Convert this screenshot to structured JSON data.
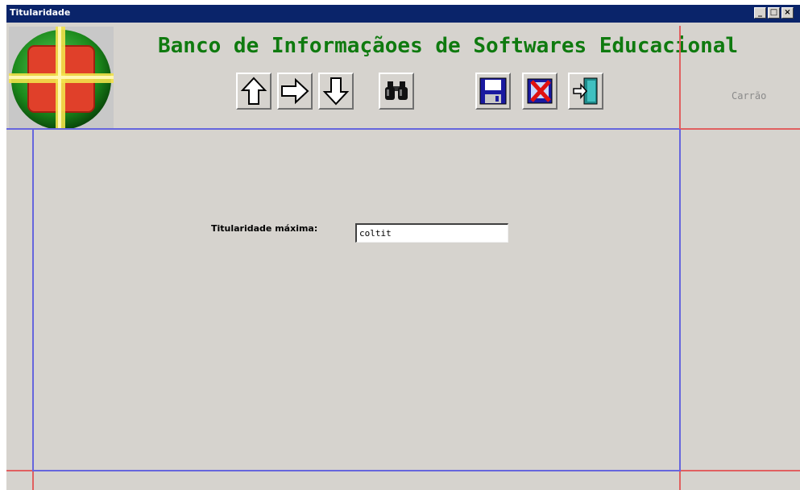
{
  "window": {
    "title": "Titularidade",
    "controls": {
      "minimize": "_",
      "maximize": "□",
      "close": "×"
    }
  },
  "header": {
    "app_title": "Banco de Informaçãoes de Softwares Educacional",
    "side_label": "Carrão"
  },
  "toolbar": {
    "buttons": [
      {
        "name": "up-arrow",
        "icon": "arrow-up-icon"
      },
      {
        "name": "right-arrow",
        "icon": "arrow-right-icon"
      },
      {
        "name": "down-arrow",
        "icon": "arrow-down-icon"
      },
      {
        "name": "find",
        "icon": "binoculars-icon"
      },
      {
        "name": "save",
        "icon": "floppy-disk-icon"
      },
      {
        "name": "delete",
        "icon": "delete-x-icon"
      },
      {
        "name": "exit",
        "icon": "exit-door-icon"
      }
    ]
  },
  "form": {
    "titularidade_label": "Titularidade máxima:",
    "titularidade_value": "coltit"
  },
  "colors": {
    "titlebar": "#0a246a",
    "title_green": "#0f7a0f",
    "guide_blue": "#6666dd",
    "guide_red": "#e06060",
    "window_bg": "#d6d3ce"
  }
}
